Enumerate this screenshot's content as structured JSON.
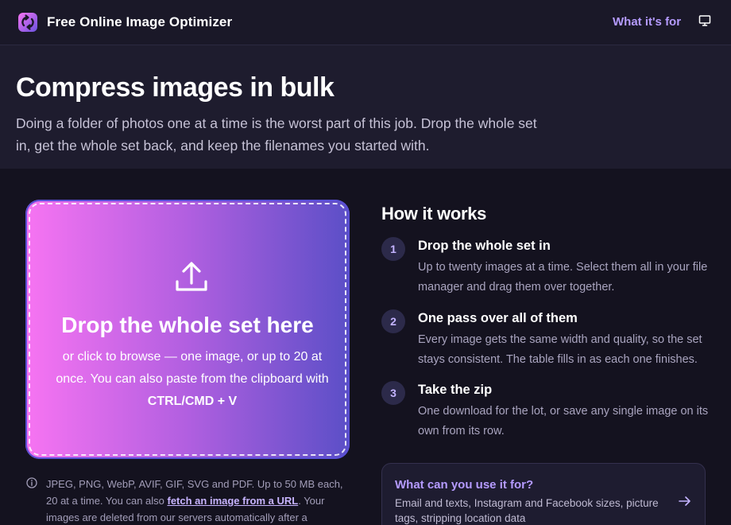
{
  "header": {
    "brand": "Free Online Image Optimizer",
    "nav_link": "What it's for",
    "icons": {
      "logo": "refresh-arrows-logo",
      "display": "monitor-icon"
    }
  },
  "hero": {
    "title": "Compress images in bulk",
    "subtitle": "Doing a folder of photos one at a time is the worst part of this job. Drop the whole set in, get the whole set back, and keep the filenames you started with."
  },
  "dropzone": {
    "title": "Drop the whole set here",
    "sub_before": "or click to browse — one image, or up to 20 at once. You can also paste from the clipboard with ",
    "shortcut": "CTRL/CMD + V",
    "icon": "upload-icon"
  },
  "info": {
    "text_before": "JPEG, PNG, WebP, AVIF, GIF, SVG and PDF. Up to 50 MB each, 20 at a time. You can also ",
    "link": "fetch an image from a URL",
    "text_after": ". Your images are deleted from our servers automatically after a"
  },
  "how": {
    "title": "How it works",
    "steps": [
      {
        "num": "1",
        "title": "Drop the whole set in",
        "desc": "Up to twenty images at a time. Select them all in your file manager and drag them over together."
      },
      {
        "num": "2",
        "title": "One pass over all of them",
        "desc": "Every image gets the same width and quality, so the set stays consistent. The table fills in as each one finishes."
      },
      {
        "num": "3",
        "title": "Take the zip",
        "desc": "One download for the lot, or save any single image on its own from its row."
      }
    ]
  },
  "card": {
    "title": "What can you use it for?",
    "desc": "Email and texts, Instagram and Facebook sizes, picture tags, stripping location data"
  },
  "colors": {
    "background": "#14121f",
    "hero": "#1e1c2e",
    "accent": "#b59bff",
    "gradient_start": "#f774f2",
    "gradient_end": "#5b4fc7"
  }
}
